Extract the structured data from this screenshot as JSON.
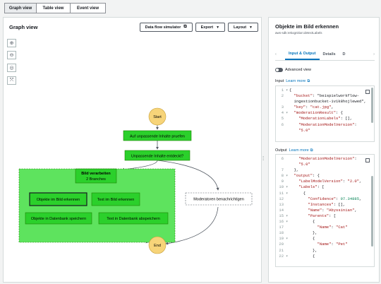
{
  "view_tabs": [
    "Graph view",
    "Table view",
    "Event view"
  ],
  "graph_panel": {
    "title": "Graph view",
    "toolbar": {
      "data_flow_simulator": "Data flow simulator",
      "export": "Export",
      "layout": "Layout"
    }
  },
  "flow": {
    "start": "Start",
    "end": "End",
    "step1": "Auf unpassende Inhalte pruefen",
    "choice": "Unpassende Inhalte entdeckt?",
    "parallel_title": "Bild verarbeiten",
    "parallel_sub": "2 Branches",
    "branch1_step1": "Objekte im Bild erkennen",
    "branch1_step2": "Objekte in Datenbank speichern",
    "branch2_step1": "Text im Bild erkennen",
    "branch2_step2": "Text in Datenbank abspeichern",
    "notify": "Moderatoren benachrichtigen"
  },
  "side_panel": {
    "title": "Objekte im Bild erkennen",
    "subtitle": "aws-sdk:rekognition:detectLabels",
    "tabs": [
      "Input & Output",
      "Details",
      "D"
    ],
    "advanced_view": "Advanced view",
    "input_label": "Input",
    "output_label": "Output",
    "learn_more": "Learn more",
    "input_lines": [
      {
        "n": "1",
        "f": "▾",
        "t": "{"
      },
      {
        "n": "2",
        "f": "",
        "t": "  \"bucket\": \"beispielworkflow-"
      },
      {
        "n": "",
        "f": "",
        "t": "  ingestionbucket-1v1k8hojlewed\","
      },
      {
        "n": "3",
        "f": "",
        "t": "  \"key\": \"cat.jpg\","
      },
      {
        "n": "4",
        "f": "▾",
        "t": "  \"moderationResult\": {"
      },
      {
        "n": "5",
        "f": "",
        "t": "    \"ModerationLabels\": [],"
      },
      {
        "n": "6",
        "f": "",
        "t": "    \"ModerationModelVersion\":"
      },
      {
        "n": "",
        "f": "",
        "t": "    \"5.0\""
      }
    ],
    "output_lines": [
      {
        "n": "6",
        "f": "",
        "t": "    \"ModerationModelVersion\":"
      },
      {
        "n": "",
        "f": "",
        "t": "    \"5.0\""
      },
      {
        "n": "7",
        "f": "",
        "t": "  },"
      },
      {
        "n": "8",
        "f": "▾",
        "t": "  \"output\": {"
      },
      {
        "n": "9",
        "f": "",
        "t": "    \"LabelModelVersion\": \"2.0\","
      },
      {
        "n": "10",
        "f": "▾",
        "t": "    \"Labels\": ["
      },
      {
        "n": "11",
        "f": "▾",
        "t": "      {"
      },
      {
        "n": "12",
        "f": "",
        "t": "        \"Confidence\": 97.34885,"
      },
      {
        "n": "13",
        "f": "",
        "t": "        \"Instances\": [],"
      },
      {
        "n": "14",
        "f": "",
        "t": "        \"Name\": \"Abyssinian\","
      },
      {
        "n": "15",
        "f": "▾",
        "t": "        \"Parents\": ["
      },
      {
        "n": "16",
        "f": "▾",
        "t": "          {"
      },
      {
        "n": "17",
        "f": "",
        "t": "            \"Name\": \"Cat\""
      },
      {
        "n": "18",
        "f": "",
        "t": "          },"
      },
      {
        "n": "19",
        "f": "▾",
        "t": "          {"
      },
      {
        "n": "20",
        "f": "",
        "t": "            \"Name\": \"Pet\""
      },
      {
        "n": "21",
        "f": "",
        "t": "          },"
      },
      {
        "n": "22",
        "f": "▾",
        "t": "          {"
      }
    ]
  },
  "colors": {
    "success": "#2bd02b",
    "success_border": "#1d8102",
    "parallel_bg": "#5ee35e",
    "start_end": "#f7d479",
    "link": "#0073bb"
  }
}
